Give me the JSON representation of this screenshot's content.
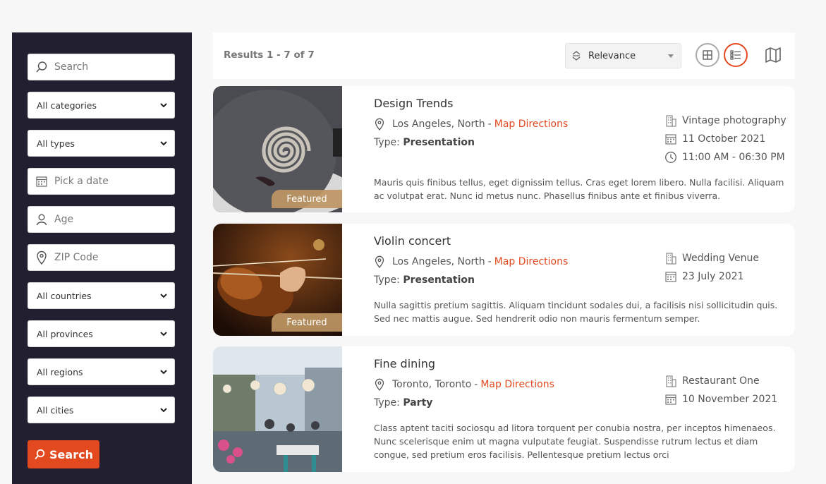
{
  "sidebar": {
    "search_placeholder": "Search",
    "categories": "All categories",
    "types": "All types",
    "date_placeholder": "Pick a date",
    "age_placeholder": "Age",
    "zip_placeholder": "ZIP Code",
    "countries": "All countries",
    "provinces": "All provinces",
    "regions": "All regions",
    "cities": "All cities",
    "search_button": "Search"
  },
  "toolbar": {
    "results": "Results 1 - 7 of 7",
    "sort_value": "Relevance"
  },
  "colors": {
    "accent": "#e2491f",
    "sidebar_bg": "#221f31",
    "featured": "#be9664"
  },
  "listings": [
    {
      "title": "Design Trends",
      "location": "Los Angeles, North",
      "directions": "Map Directions",
      "type_label": "Type:",
      "type": "Presentation",
      "venue": "Vintage photography",
      "date": "11 October 2021",
      "time": "11:00 AM - 06:30 PM",
      "badge": "Featured",
      "description": "Mauris quis finibus tellus, eget dignissim tellus. Cras eget lorem libero. Nulla facilisi. Aliquam ac volutpat erat. Nunc id metus nunc. Phasellus finibus ante et finibus viverra."
    },
    {
      "title": "Violin concert",
      "location": "Los Angeles, North",
      "directions": "Map Directions",
      "type_label": "Type:",
      "type": "Presentation",
      "venue": "Wedding Venue",
      "date": "23 July 2021",
      "badge": "Featured",
      "description": "Nulla sagittis pretium sagittis. Aliquam tincidunt sodales dui, a facilisis nisi sollicitudin quis. Sed nec mattis augue. Sed hendrerit odio non mauris fermentum semper."
    },
    {
      "title": "Fine dining",
      "location": "Toronto, Toronto",
      "directions": "Map Directions",
      "type_label": "Type:",
      "type": "Party",
      "venue": "Restaurant One",
      "date": "10 November 2021",
      "description": "Class aptent taciti sociosqu ad litora torquent per conubia nostra, per inceptos himenaeos. Nunc scelerisque enim ut magna vulputate feugiat. Suspendisse rutrum lectus et diam congue, sed pretium eros facilisis. Pellentesque pretium lectus orci"
    }
  ]
}
